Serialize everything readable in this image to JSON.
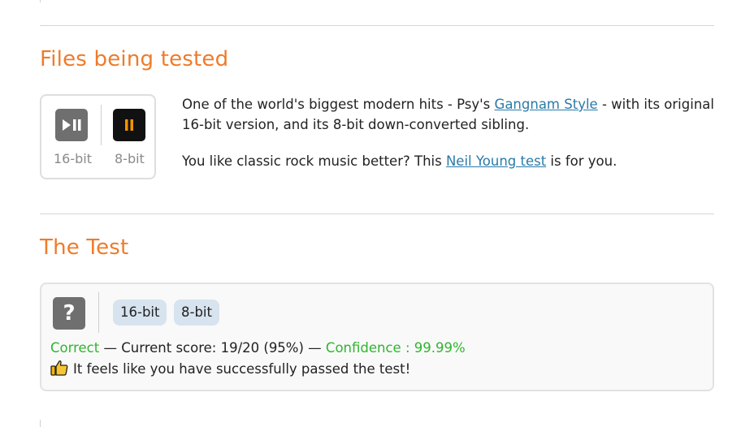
{
  "section_files": {
    "heading": "Files being tested",
    "player": {
      "label_a": "16-bit",
      "label_b": "8-bit",
      "icon_a": "play-pause-icon",
      "icon_b": "pause-icon"
    },
    "desc": {
      "p1_before": "One of the world's biggest modern hits - Psy's ",
      "p1_link": "Gangnam Style",
      "p1_after": " - with its original 16-bit version, and its 8-bit down-converted sibling.",
      "p2_before": "You like classic rock music better? This ",
      "p2_link": "Neil Young test",
      "p2_after": " is for you."
    }
  },
  "section_test": {
    "heading": "The Test",
    "question_mark": "?",
    "choice_a": "16-bit",
    "choice_b": "8-bit",
    "correct": "Correct",
    "score_text": " — Current score: 19/20 (95%) — ",
    "confidence": "Confidence : 99.99%",
    "message": "It feels like you have successfully passed the test!",
    "icon_thumb": "thumbs-up-icon"
  },
  "colors": {
    "heading": "#ef7b2a",
    "link": "#2a7aa8",
    "success": "#2fb52f",
    "chip_bg": "#d7e3ef"
  }
}
